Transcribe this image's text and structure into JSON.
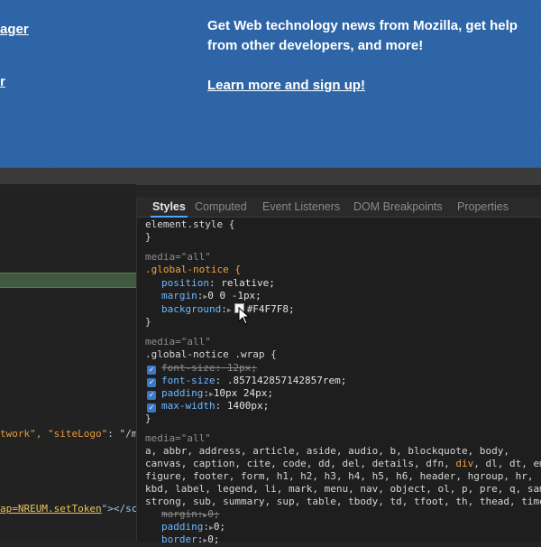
{
  "webpage": {
    "left_link_1": "ager",
    "left_link_2": "r",
    "intro_text": "Get Web technology news from Mozilla, get help from other developers, and more!",
    "signup_link": "Learn more and sign up!"
  },
  "code_panel": {
    "line1": {
      "prefix": "twork\", ",
      "key": "\"siteLogo\"",
      "rest": ": \"/m"
    },
    "line2": {
      "prefix": "ap=NREUM.setToken",
      "rest": "\"></sc"
    }
  },
  "tabs": [
    "Styles",
    "Computed",
    "Event Listeners",
    "DOM Breakpoints",
    "Properties"
  ],
  "styles": {
    "element_style": "element.style {",
    "close": "}",
    "rule1": {
      "media": "media=\"all\"",
      "selector": ".global-notice {",
      "props": [
        {
          "name": "position",
          "value": "relative;"
        },
        {
          "name": "margin",
          "value": "0 0 -1px;"
        },
        {
          "name": "background",
          "value": "#F4F7F8;"
        }
      ]
    },
    "rule2": {
      "media": "media=\"all\"",
      "selector": ".global-notice .wrap {",
      "props": [
        {
          "name": "font-size",
          "value": "12px;"
        },
        {
          "name": "font-size",
          "value": ".857142857142857rem;"
        },
        {
          "name": "padding",
          "value": "10px 24px;"
        },
        {
          "name": "max-width",
          "value": "1400px;"
        }
      ]
    },
    "rule3": {
      "media": "media=\"all\"",
      "selector_lines": [
        "a, abbr, address, article, aside, audio, b, blockquote, body,",
        "canvas, caption, cite, code, dd, del, details, dfn, ",
        "figure, footer, form, h1, h2, h3, h4, h5, h6, header, hgroup, hr, ",
        "kbd, label, legend, li, mark, menu, nav, object, ol, p, pre, q, sam",
        "strong, sub, summary, sup, table, tbody, td, tfoot, th, thead, time"
      ],
      "line2_hl": "div",
      "line2_tail": ", dl, dt, em",
      "props": [
        {
          "name": "margin",
          "value": "0;"
        },
        {
          "name": "padding",
          "value": "0;"
        },
        {
          "name": "border",
          "value": "0;"
        }
      ]
    }
  }
}
